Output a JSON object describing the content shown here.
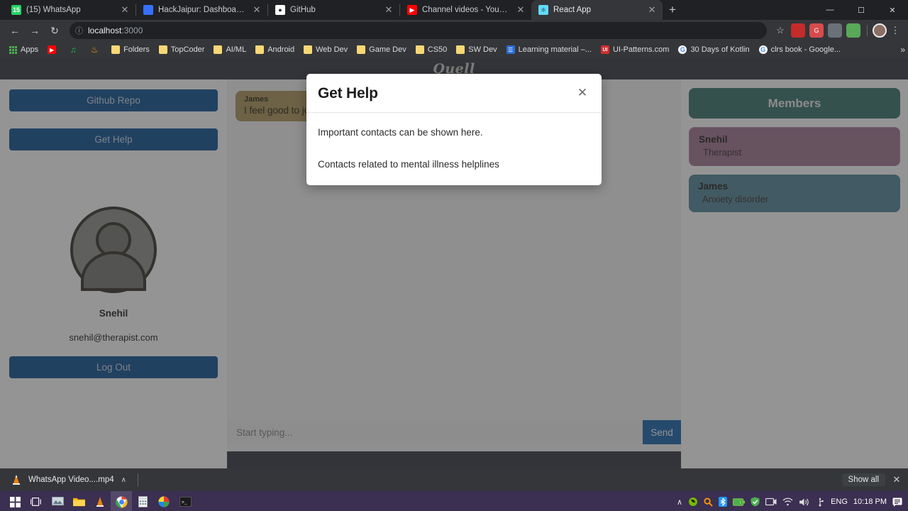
{
  "browser": {
    "tabs": [
      {
        "title": "(15) WhatsApp",
        "icon": "whatsapp-icon",
        "glyph": "15",
        "active": false
      },
      {
        "title": "HackJaipur: Dashboard | Devfolio",
        "icon": "devfolio-icon",
        "glyph": "",
        "active": false
      },
      {
        "title": "GitHub",
        "icon": "github-icon",
        "glyph": "●",
        "active": false
      },
      {
        "title": "Channel videos - YouTube Studio",
        "icon": "youtube-icon",
        "glyph": "▶",
        "active": false
      },
      {
        "title": "React App",
        "icon": "react-icon",
        "glyph": "⚛",
        "active": true
      }
    ],
    "new_tab_label": "+",
    "window_controls": {
      "minimize": "—",
      "maximize": "☐",
      "close": "✕"
    },
    "nav": {
      "back": "←",
      "forward": "→",
      "reload": "↻"
    },
    "omnibox": {
      "site_info_icon": "info-circle-icon",
      "url_host": "localhost",
      "url_port": ":3000",
      "star_icon": "☆"
    },
    "extensions": [
      {
        "name": "recorder-extension-icon",
        "glyph": "●",
        "color": "#c42b2b"
      },
      {
        "name": "grammarly-extension-icon",
        "glyph": "G",
        "color": "#d64b4b"
      },
      {
        "name": "toolbox-extension-icon",
        "glyph": "⬚",
        "color": "#6b7178"
      },
      {
        "name": "colorpicker-extension-icon",
        "glyph": "✿",
        "color": "#5aa85a"
      }
    ],
    "menu_icon": "⋮",
    "bookmarks": [
      {
        "label": "Apps",
        "icon": "apps-grid-icon"
      },
      {
        "label": "",
        "icon": "youtube-bookmark-icon"
      },
      {
        "label": "",
        "icon": "spotify-bookmark-icon"
      },
      {
        "label": "",
        "icon": "flame-bookmark-icon"
      },
      {
        "label": "Folders",
        "icon": "folder-icon"
      },
      {
        "label": "TopCoder",
        "icon": "folder-icon"
      },
      {
        "label": "AI/ML",
        "icon": "folder-icon"
      },
      {
        "label": "Android",
        "icon": "folder-icon"
      },
      {
        "label": "Web Dev",
        "icon": "folder-icon"
      },
      {
        "label": "Game Dev",
        "icon": "folder-icon"
      },
      {
        "label": "CS50",
        "icon": "folder-icon"
      },
      {
        "label": "SW Dev",
        "icon": "folder-icon"
      },
      {
        "label": "Learning material –...",
        "icon": "doc-bookmark-icon"
      },
      {
        "label": "UI-Patterns.com",
        "icon": "ui-patterns-icon"
      },
      {
        "label": "30 Days of Kotlin",
        "icon": "google-icon"
      },
      {
        "label": "clrs book - Google...",
        "icon": "google-icon"
      }
    ],
    "bookmarks_overflow": "»"
  },
  "app": {
    "logo": "Quell",
    "sidebar": {
      "github_repo_label": "Github Repo",
      "get_help_label": "Get Help",
      "avatar_icon": "user-avatar-icon",
      "profile_name": "Snehil",
      "profile_email": "snehil@therapist.com",
      "logout_label": "Log Out"
    },
    "chat": {
      "messages": [
        {
          "sender": "James",
          "text": "I feel good to jo"
        }
      ],
      "input_value": "",
      "input_placeholder": "Start typing...",
      "send_label": "Send"
    },
    "members": {
      "title": "Members",
      "list": [
        {
          "name": "Snehil",
          "role": "Therapist",
          "type": "therapist"
        },
        {
          "name": "James",
          "role": "Anxiety disorder",
          "type": "patient"
        }
      ]
    },
    "modal": {
      "title": "Get Help",
      "close_icon": "✕",
      "paragraphs": [
        "Important contacts can be shown here.",
        "Contacts related to mental illness helplines"
      ]
    },
    "colors": {
      "accent_blue": "#00488f",
      "send_blue": "#0d5ca8",
      "members_header_teal": "#2d6a63",
      "therapist_card": "#9b6e8c",
      "patient_card": "#4b7f93",
      "bubble_gold": "#a98e53",
      "app_header_dark": "#282c37"
    }
  },
  "downloads": {
    "file_name": "WhatsApp Video....mp4",
    "file_icon": "vlc-cone-icon",
    "caret": "∧",
    "show_all_label": "Show all",
    "close_icon": "✕"
  },
  "taskbar": {
    "items": [
      {
        "name": "start-button",
        "glyph": "⊞"
      },
      {
        "name": "task-view-button",
        "glyph": "⧉"
      },
      {
        "name": "photos-app-icon",
        "glyph": "⛰"
      },
      {
        "name": "file-explorer-icon",
        "glyph": "▮"
      },
      {
        "name": "vlc-player-icon",
        "glyph": "▲"
      },
      {
        "name": "chrome-browser-icon",
        "glyph": "◉",
        "active": true
      },
      {
        "name": "calculator-icon",
        "glyph": "⊞"
      },
      {
        "name": "photoshop-icon",
        "glyph": "⬤"
      },
      {
        "name": "terminal-icon",
        "glyph": "▣"
      }
    ],
    "tray": {
      "chevron": "∧",
      "icons": [
        "nvidia-tray-icon",
        "search-tray-icon",
        "bluetooth-tray-icon",
        "battery-tray-icon",
        "defender-tray-icon",
        "cast-tray-icon",
        "wifi-tray-icon",
        "volume-tray-icon",
        "usb-tray-icon"
      ],
      "language": "ENG",
      "time": "10:18 PM",
      "notification_icon": "notification-icon"
    }
  }
}
